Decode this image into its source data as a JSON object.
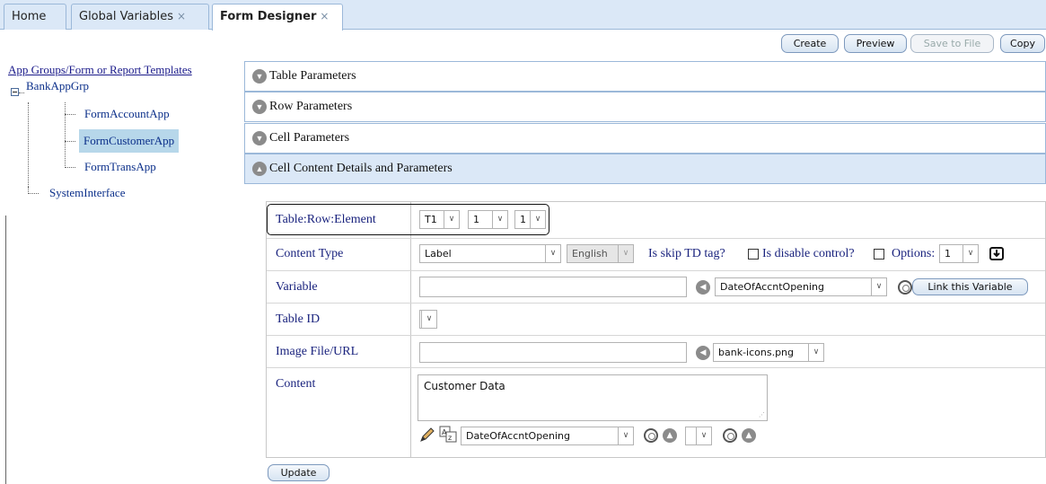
{
  "tabs": [
    {
      "label": "Home",
      "closable": false
    },
    {
      "label": "Global Variables",
      "closable": true
    },
    {
      "label": "Form Designer",
      "closable": true,
      "active": true
    }
  ],
  "tab_close_glyph": "×",
  "toolbar": {
    "create": "Create",
    "preview": "Preview",
    "save_to_file": "Save to File",
    "copy": "Copy"
  },
  "tree": {
    "root": "App Groups/Form or Report Templates",
    "group": "BankAppGrp",
    "items": [
      "FormAccountApp",
      "FormCustomerApp",
      "FormTransApp"
    ],
    "selected": "FormCustomerApp",
    "other": "SystemInterface"
  },
  "accordion": [
    {
      "label": "Table Parameters",
      "expanded": false
    },
    {
      "label": "Row Parameters",
      "expanded": false
    },
    {
      "label": "Cell Parameters",
      "expanded": false
    },
    {
      "label": "Cell Content Details and Parameters",
      "expanded": true
    }
  ],
  "form": {
    "table_row_element": {
      "label": "Table:Row:Element",
      "table": "T1",
      "row": "1",
      "element": "1"
    },
    "content_type": {
      "label": "Content Type",
      "value": "Label",
      "language": "English",
      "skip_td_label": "Is skip TD tag?",
      "disable_control_label": "Is disable control?",
      "options_label": "Options:",
      "options_value": "1"
    },
    "variable": {
      "label": "Variable",
      "value": "",
      "selected_variable": "DateOfAccntOpening",
      "link_button": "Link this Variable"
    },
    "table_id": {
      "label": "Table ID",
      "value": ""
    },
    "image_file": {
      "label": "Image File/URL",
      "value": "",
      "selected_image": "bank-icons.png"
    },
    "content": {
      "label": "Content",
      "value": "Customer Data",
      "variable_select": "DateOfAccntOpening",
      "second_select": ""
    }
  },
  "update_button": "Update",
  "colors": {
    "accent": "#dbe8f7",
    "label_text": "#1a237e",
    "selection": "#b7d7ea"
  }
}
